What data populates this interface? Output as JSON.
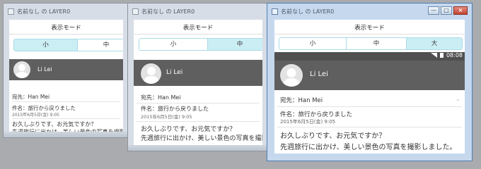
{
  "window_title": "名前なし の LAYER0",
  "header": {
    "title": "表示モード"
  },
  "display_modes": [
    "小",
    "中",
    "大"
  ],
  "status": {
    "time": "08:08"
  },
  "profile": {
    "name": "Li Lei"
  },
  "message": {
    "to_label": "宛先：",
    "to": "Han Mei",
    "subject_label": "件名：",
    "subject": "旅行から戻りました",
    "date": "2015年6月5日(金) 9:05",
    "body_line1": "お久しぶりです、お元気ですか？",
    "body_line2": "先週旅行に出かけ、美しい景色の写真を撮影しました。"
  },
  "window_controls": {
    "minimize": "—",
    "maximize": "□",
    "close": "×"
  }
}
